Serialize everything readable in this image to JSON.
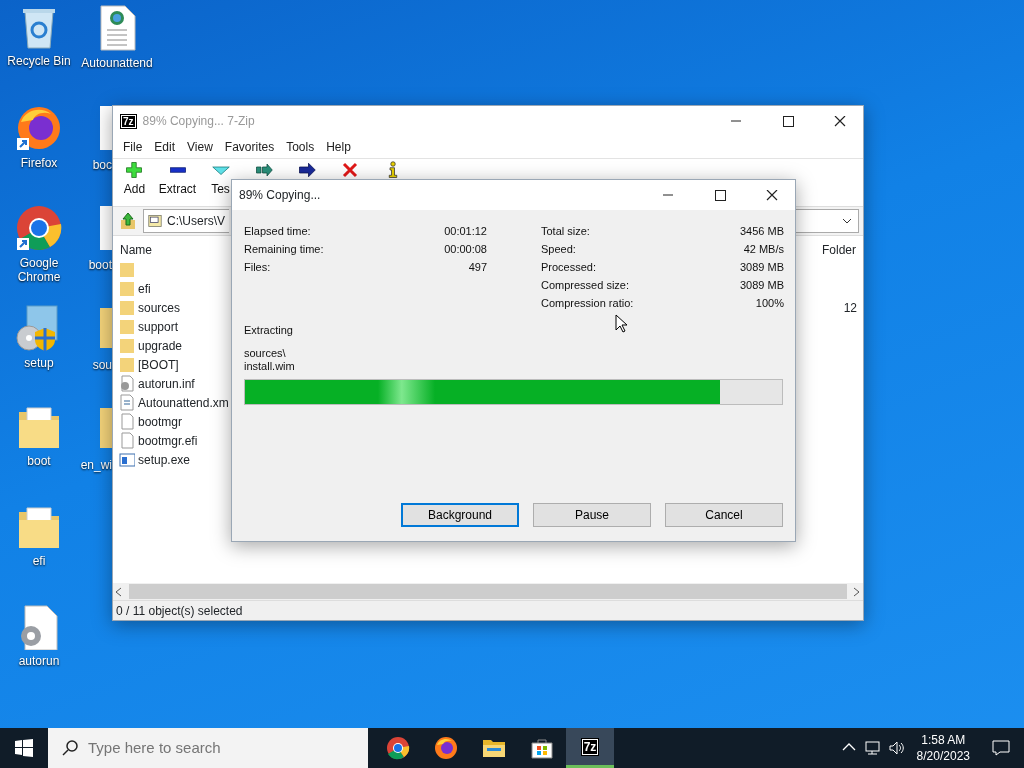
{
  "desktop_icons": [
    [
      {
        "kind": "recycle-bin",
        "label": "Recycle Bin",
        "cut": false
      },
      {
        "kind": "firefox",
        "label": "Firefox",
        "cut": false
      },
      {
        "kind": "chrome",
        "label": "Google Chrome",
        "cut": false
      },
      {
        "kind": "setup",
        "label": "setup",
        "cut": false
      },
      {
        "kind": "folder-docs",
        "label": "boot",
        "cut": false
      },
      {
        "kind": "folder-docs",
        "label": "efi",
        "cut": false
      },
      {
        "kind": "settings-file",
        "label": "autorun",
        "cut": false
      }
    ],
    [
      {
        "kind": "web-doc",
        "label": "Autounattend",
        "cut": false
      },
      {
        "kind": "blank-file",
        "label": "boc",
        "cut": true
      },
      {
        "kind": "blank-file",
        "label": "boot",
        "cut": true
      },
      {
        "kind": "folder",
        "label": "sou",
        "cut": true
      },
      {
        "kind": "folder",
        "label": "en_wi",
        "cut": true
      }
    ]
  ],
  "main_window": {
    "icon_text": "7z",
    "title": "89% Copying... 7-Zip",
    "active": false,
    "menu": [
      "File",
      "Edit",
      "View",
      "Favorites",
      "Tools",
      "Help"
    ],
    "toolbar": [
      {
        "kind": "add",
        "label": "Add"
      },
      {
        "kind": "extract",
        "label": "Extract"
      },
      {
        "kind": "test",
        "label": "Tes"
      },
      {
        "kind": "copy"
      },
      {
        "kind": "move"
      },
      {
        "kind": "delete"
      },
      {
        "kind": "info"
      }
    ],
    "address": "C:\\Users\\V",
    "columns": [
      "Name",
      "Folder"
    ],
    "files": [
      {
        "kind": "folder"
      },
      {
        "kind": "folder",
        "name": "efi"
      },
      {
        "kind": "folder",
        "name": "sources",
        "folder": "12"
      },
      {
        "kind": "folder",
        "name": "support"
      },
      {
        "kind": "folder",
        "name": "upgrade"
      },
      {
        "kind": "folder",
        "name": "[BOOT]"
      },
      {
        "kind": "settings-file",
        "name": "autorun.inf"
      },
      {
        "kind": "web-doc",
        "name": "Autounattend.xm"
      },
      {
        "kind": "blank-file",
        "name": "bootmgr"
      },
      {
        "kind": "blank-file",
        "name": "bootmgr.efi"
      },
      {
        "kind": "exe",
        "name": "setup.exe"
      }
    ],
    "status": "0 / 11 object(s) selected"
  },
  "dialog": {
    "title": "89% Copying...",
    "left_stats": [
      {
        "label": "Elapsed time:",
        "value": "00:01:12"
      },
      {
        "label": "Remaining time:",
        "value": "00:00:08"
      },
      {
        "label": "Files:",
        "value": "497"
      }
    ],
    "right_stats": [
      {
        "label": "Total size:",
        "value": "3456 MB"
      },
      {
        "label": "Speed:",
        "value": "42 MB/s"
      },
      {
        "label": "Processed:",
        "value": "3089 MB"
      },
      {
        "label": "Compressed size:",
        "value": "3089 MB"
      },
      {
        "label": "Compression ratio:",
        "value": "100%"
      }
    ],
    "operation": "Extracting",
    "path_lines": [
      "sources\\",
      "install.wim"
    ],
    "progress": {
      "level": 0.885
    },
    "buttons": [
      {
        "label": "Background",
        "focused": true
      },
      {
        "label": "Pause",
        "focused": false
      },
      {
        "label": "Cancel",
        "focused": false
      }
    ]
  },
  "taskbar": {
    "search_placeholder": "Type here to search",
    "apps": [
      {
        "kind": "chrome",
        "active": false
      },
      {
        "kind": "firefox",
        "active": false
      },
      {
        "kind": "explorer",
        "active": false
      },
      {
        "kind": "store",
        "active": false
      },
      {
        "kind": "sevenzip",
        "label": "7z",
        "active": true
      }
    ],
    "time": "1:58 AM",
    "date": "8/20/2023"
  }
}
